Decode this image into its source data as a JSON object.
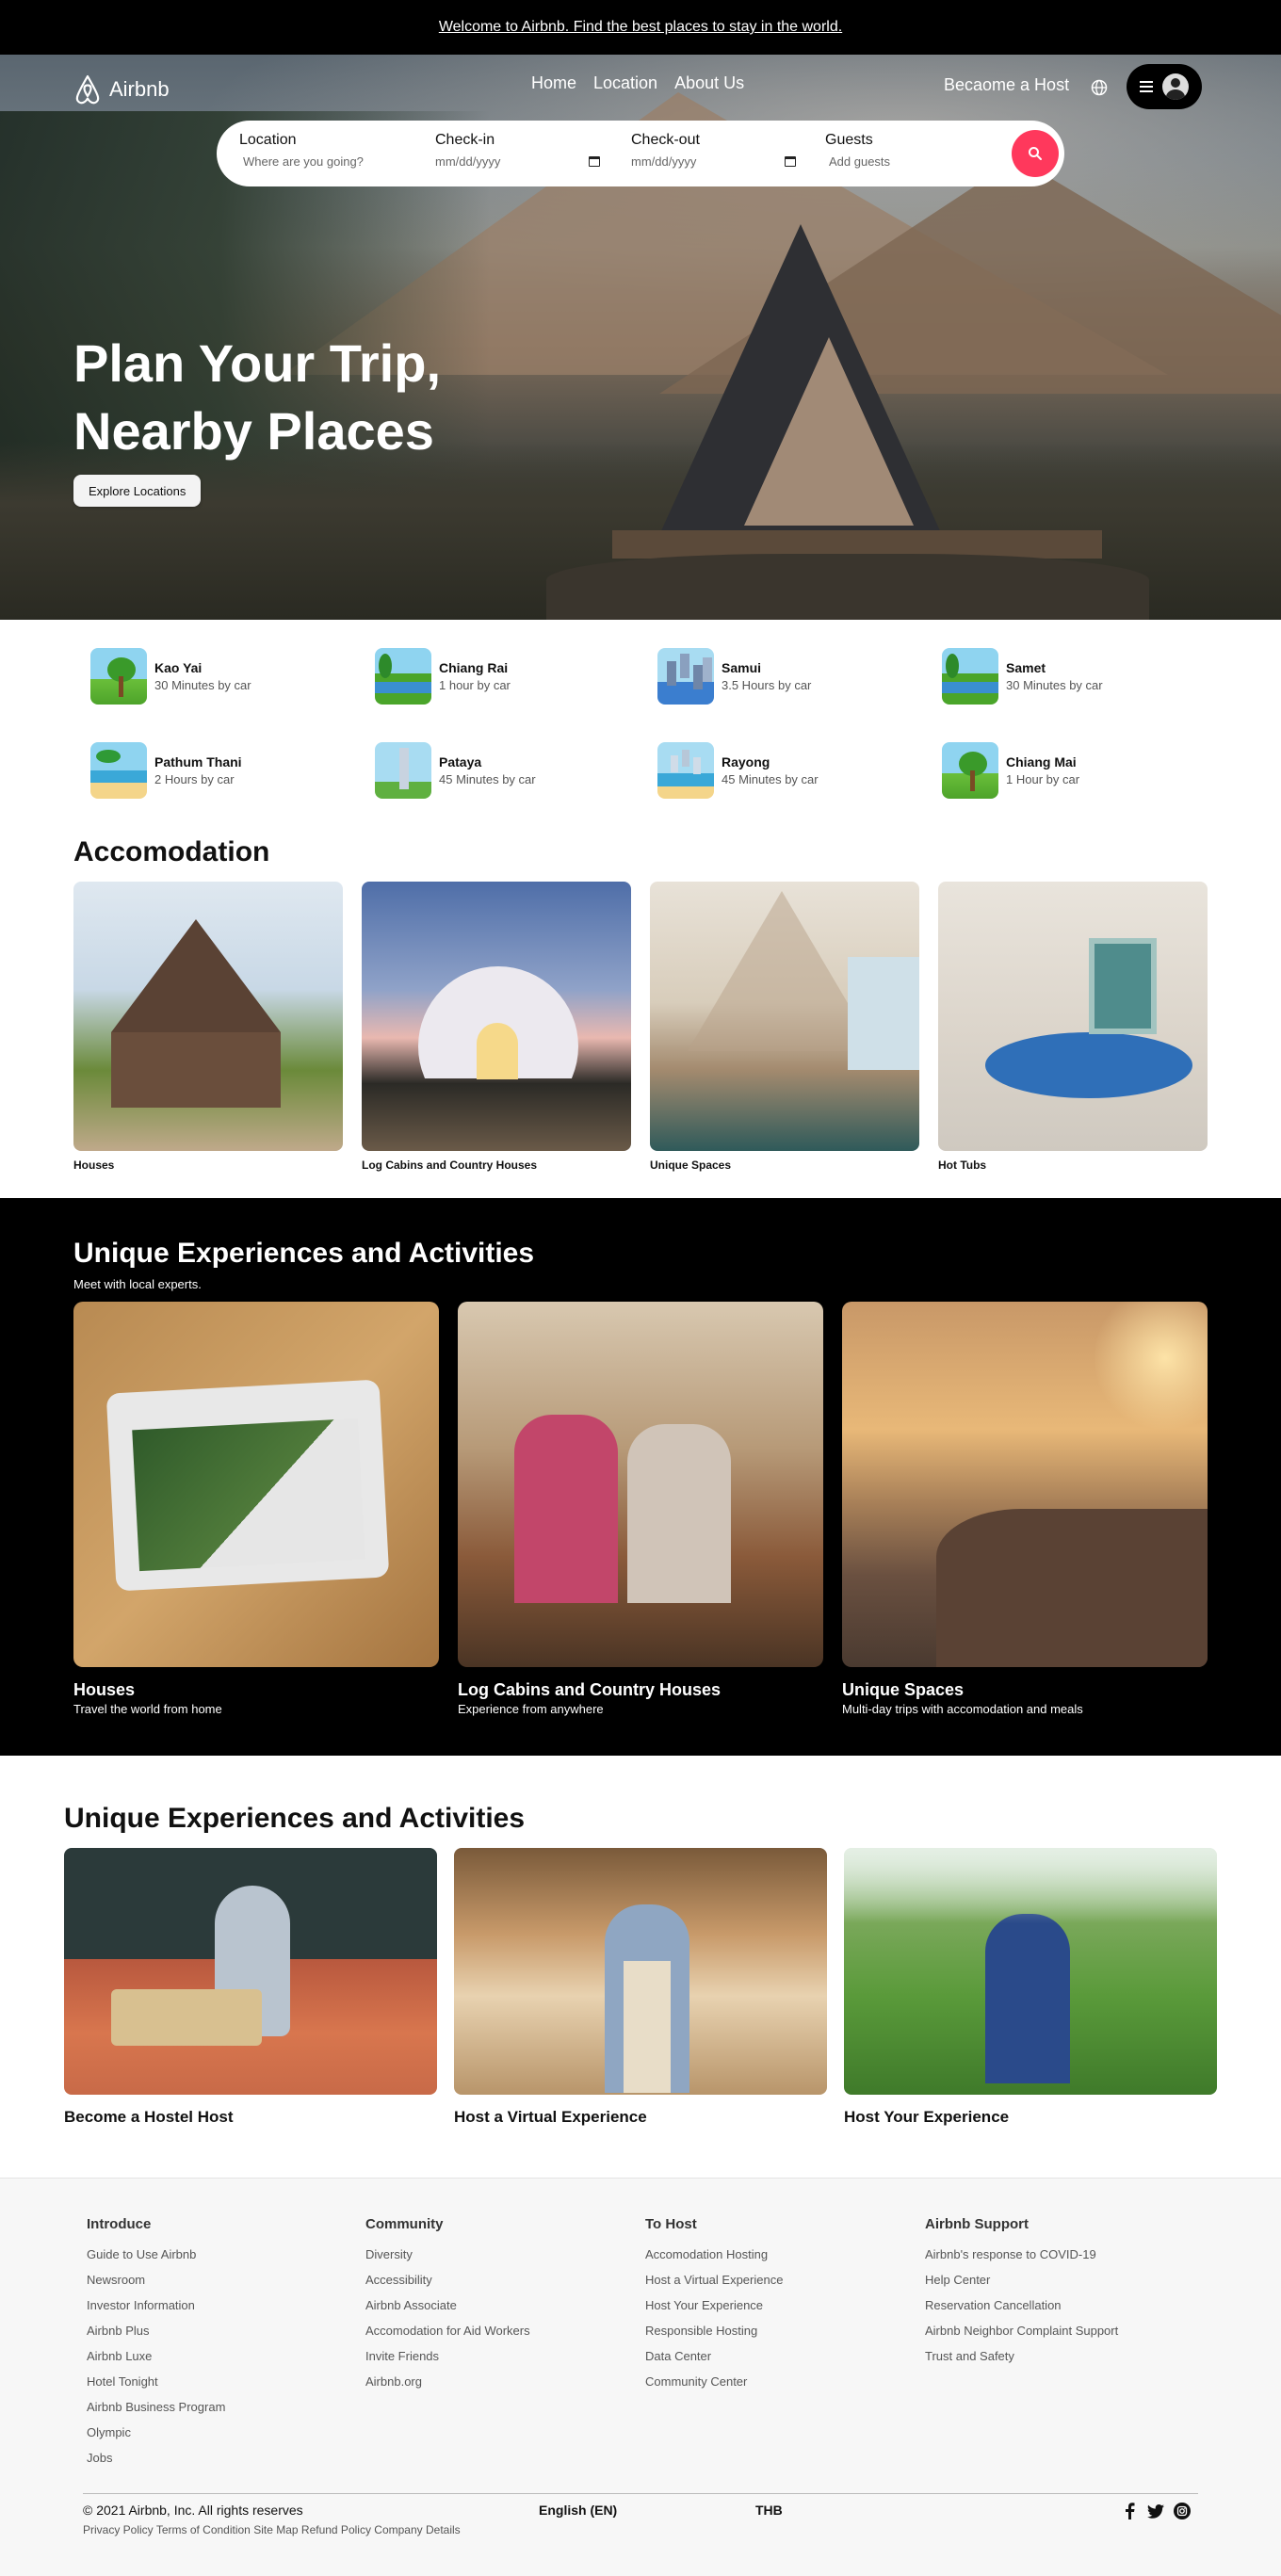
{
  "banner": {
    "text": "Welcome to Airbnb. Find the best places to stay in the world."
  },
  "header": {
    "brand": "Airbnb",
    "nav": [
      "Home",
      "Location",
      "About Us"
    ],
    "become_host": "Becaome a Host"
  },
  "search": {
    "location": {
      "label": "Location",
      "placeholder": "Where are you going?"
    },
    "checkin": {
      "label": "Check-in",
      "value": "mm/dd/yyyy"
    },
    "checkout": {
      "label": "Check-out",
      "value": "mm/dd/yyyy"
    },
    "guests": {
      "label": "Guests",
      "placeholder": "Add guests"
    }
  },
  "hero": {
    "title_line1": "Plan Your Trip,",
    "title_line2": "Nearby Places",
    "cta": "Explore Locations"
  },
  "nearby": [
    {
      "name": "Kao Yai",
      "distance": "30 Minutes by car"
    },
    {
      "name": "Chiang Rai",
      "distance": "1 hour by car"
    },
    {
      "name": "Samui",
      "distance": "3.5 Hours by car"
    },
    {
      "name": "Samet",
      "distance": "30 Minutes by car"
    },
    {
      "name": "Pathum Thani",
      "distance": "2 Hours by car"
    },
    {
      "name": "Pataya",
      "distance": "45 Minutes by car"
    },
    {
      "name": "Rayong",
      "distance": "45 Minutes by car"
    },
    {
      "name": "Chiang Mai",
      "distance": "1 Hour by car"
    }
  ],
  "accommodation": {
    "title": "Accomodation",
    "items": [
      "Houses",
      "Log Cabins and Country Houses",
      "Unique Spaces",
      "Hot Tubs"
    ]
  },
  "experiences": {
    "title": "Unique Experiences and Activities",
    "subtitle": "Meet with local experts.",
    "items": [
      {
        "name": "Houses",
        "desc": "Travel the world from home"
      },
      {
        "name": "Log Cabins and Country Houses",
        "desc": "Experience from anywhere"
      },
      {
        "name": "Unique Spaces",
        "desc": "Multi-day trips with accomodation and meals"
      }
    ]
  },
  "hosting": {
    "title": "Unique Experiences and Activities",
    "items": [
      "Become a Hostel Host",
      "Host a Virtual Experience",
      "Host Your Experience"
    ]
  },
  "footer": {
    "columns": [
      {
        "title": "Introduce",
        "links": [
          "Guide to Use Airbnb",
          "Newsroom",
          "Investor Information",
          "Airbnb Plus",
          "Airbnb Luxe",
          "Hotel Tonight",
          "Airbnb Business Program",
          "Olympic",
          "Jobs"
        ]
      },
      {
        "title": "Community",
        "links": [
          "Diversity",
          "Accessibility",
          "Airbnb Associate",
          "Accomodation for Aid Workers",
          "Invite Friends",
          "Airbnb.org"
        ]
      },
      {
        "title": "To Host",
        "links": [
          "Accomodation Hosting",
          "Host a Virtual Experience",
          "Host Your Experience",
          "Responsible Hosting",
          "Data Center",
          "Community Center"
        ]
      },
      {
        "title": "Airbnb Support",
        "links": [
          "Airbnb's response to COVID-19",
          "Help Center",
          "Reservation Cancellation",
          "Airbnb Neighbor Complaint Support",
          "Trust and Safety"
        ]
      }
    ],
    "copyright": "© 2021 Airbnb, Inc. All rights reserves",
    "legal": [
      "Privacy Policy",
      "Terms of Condition",
      "Site Map",
      "Refund Policy",
      "Company Details"
    ],
    "language": "English (EN)",
    "currency": "THB",
    "social_icons": [
      "facebook-icon",
      "twitter-icon",
      "instagram-icon"
    ]
  },
  "colors": {
    "accent": "#ff385c",
    "dark": "#000000",
    "footer_bg": "#f7f7f7"
  }
}
